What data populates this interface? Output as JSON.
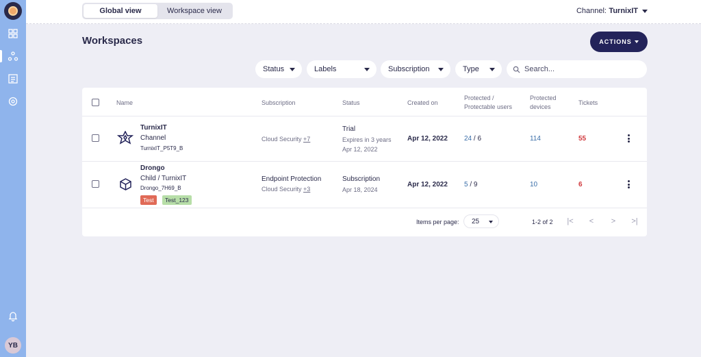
{
  "topbar": {
    "view_tabs": [
      {
        "label": "Global view",
        "active": true
      },
      {
        "label": "Workspace view",
        "active": false
      }
    ],
    "channel_label": "Channel:",
    "channel_value": "TurnixIT"
  },
  "sidebar": {
    "items": [
      "dashboard-icon",
      "workspaces-icon",
      "list-icon",
      "settings-icon"
    ],
    "active_index": 1,
    "notification_icon": "bell-icon",
    "avatar_initials": "YB"
  },
  "page": {
    "title": "Workspaces",
    "actions_label": "ACTIONS"
  },
  "filters": {
    "status": "Status",
    "labels": "Labels",
    "subscription": "Subscription",
    "type": "Type",
    "search_placeholder": "Search..."
  },
  "table": {
    "headers": {
      "name": "Name",
      "subscription": "Subscription",
      "status": "Status",
      "created": "Created on",
      "protected_users_1": "Protected /",
      "protected_users_2": "Protectable users",
      "protected_devices_1": "Protected",
      "protected_devices_2": "devices",
      "tickets": "Tickets"
    },
    "rows": [
      {
        "name": "TurnixIT",
        "type": "Channel",
        "code": "TurnixIT_P5T9_B",
        "icon": "channel-star-icon",
        "subscription_main": "",
        "subscription_sub": "Cloud Security",
        "subscription_more": "+7",
        "status": "Trial",
        "status_detail": "Expires in 3 years",
        "status_date": "Apr 12, 2022",
        "created": "Apr 12, 2022",
        "users_protected": "24",
        "users_protectable": "/ 6",
        "devices": "114",
        "tickets": "55",
        "tags": []
      },
      {
        "name": "Drongo",
        "type": "Child / TurnixIT",
        "code": "Drongo_7H69_B",
        "icon": "cube-icon",
        "subscription_main": "Endpoint Protection",
        "subscription_sub": "Cloud Security",
        "subscription_more": "+3",
        "status": "Subscription",
        "status_detail": "",
        "status_date": "Apr 18, 2024",
        "created": "Apr 12, 2022",
        "users_protected": "5",
        "users_protectable": "/ 9",
        "devices": "10",
        "tickets": "6",
        "tags": [
          {
            "label": "Test",
            "color": "#e06a57"
          },
          {
            "label": "Test_123",
            "color": "#b7dea8"
          }
        ]
      }
    ]
  },
  "pagination": {
    "items_per_page_label": "Items per page:",
    "items_per_page_value": "25",
    "range": "1-2 of 2",
    "first": "|<",
    "prev": "<",
    "next": ">",
    "last": ">|"
  },
  "colors": {
    "sidebar": "#8fb4ec",
    "primary": "#23235a",
    "link": "#3a6ea8",
    "danger": "#d0393d",
    "background": "#eeeef5"
  }
}
